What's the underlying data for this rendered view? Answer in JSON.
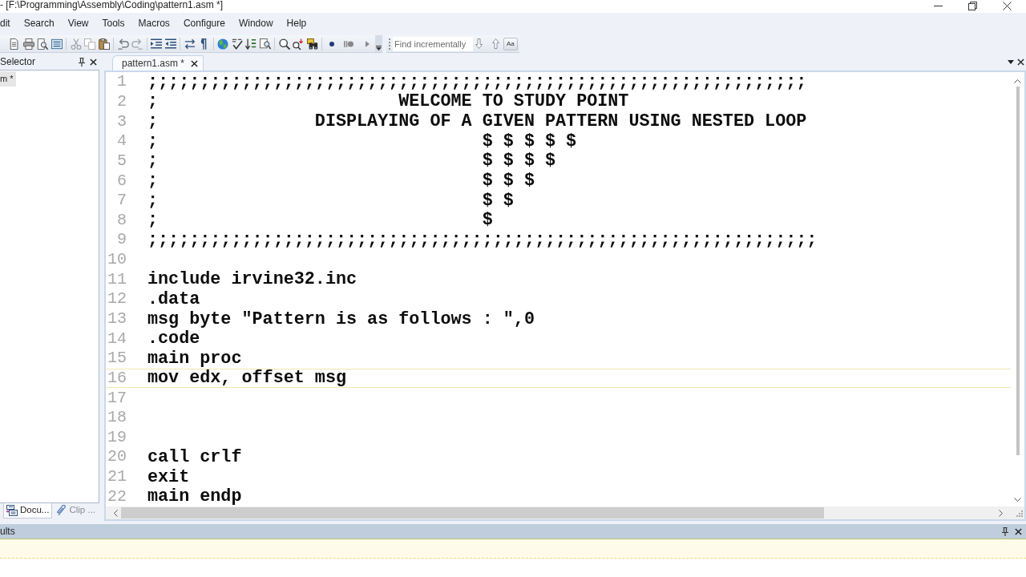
{
  "window": {
    "title": "- [F:\\Programming\\Assembly\\Coding\\pattern1.asm *]"
  },
  "menu": [
    "dit",
    "Search",
    "View",
    "Tools",
    "Macros",
    "Configure",
    "Window",
    "Help"
  ],
  "find_bar": {
    "placeholder": "Find incrementally",
    "match_case": "Aa"
  },
  "side_panel": {
    "title": "Selector",
    "items": [
      {
        "label": "m *",
        "selected": true
      }
    ],
    "tabs": [
      {
        "label": "Docu...",
        "selected": true
      },
      {
        "label": "Clip ...",
        "selected": false
      }
    ]
  },
  "editor": {
    "tabs": [
      {
        "label": "pattern1.asm *",
        "selected": true
      }
    ],
    "lines": [
      {
        "number": "1",
        "text": ";;;;;;;;;;;;;;;;;;;;;;;;;;;;;;;;;;;;;;;;;;;;;;;;;;;;;;;;;;;;;;;",
        "current": false
      },
      {
        "number": "2",
        "text": ";                       WELCOME TO STUDY POINT",
        "current": false
      },
      {
        "number": "3",
        "text": ";               DISPLAYING OF A GIVEN PATTERN USING NESTED LOOP",
        "current": false
      },
      {
        "number": "4",
        "text": ";                               $ $ $ $ $",
        "current": false
      },
      {
        "number": "5",
        "text": ";                               $ $ $ $",
        "current": false
      },
      {
        "number": "6",
        "text": ";                               $ $ $",
        "current": false
      },
      {
        "number": "7",
        "text": ";                               $ $",
        "current": false
      },
      {
        "number": "8",
        "text": ";                               $",
        "current": false
      },
      {
        "number": "9",
        "text": ";;;;;;;;;;;;;;;;;;;;;;;;;;;;;;;;;;;;;;;;;;;;;;;;;;;;;;;;;;;;;;;;",
        "current": false
      },
      {
        "number": "10",
        "current": false
      },
      {
        "number": "11",
        "text": "include irvine32.inc",
        "current": false
      },
      {
        "number": "12",
        "text": ".data",
        "current": false
      },
      {
        "number": "13",
        "text": "msg byte \"Pattern is as follows : \",0",
        "current": false
      },
      {
        "number": "14",
        "text": ".code",
        "current": false
      },
      {
        "number": "15",
        "text": "main proc",
        "current": false
      },
      {
        "number": "16",
        "text": "mov edx, offset msg",
        "current": true
      },
      {
        "number": "17",
        "current": false
      },
      {
        "number": "18",
        "current": false
      },
      {
        "number": "19",
        "current": false
      },
      {
        "number": "20",
        "text": "call crlf",
        "current": false
      },
      {
        "number": "21",
        "text": "exit",
        "current": false
      },
      {
        "number": "22",
        "text": "main endp",
        "current": false
      }
    ]
  },
  "results_panel": {
    "title": "ults"
  }
}
